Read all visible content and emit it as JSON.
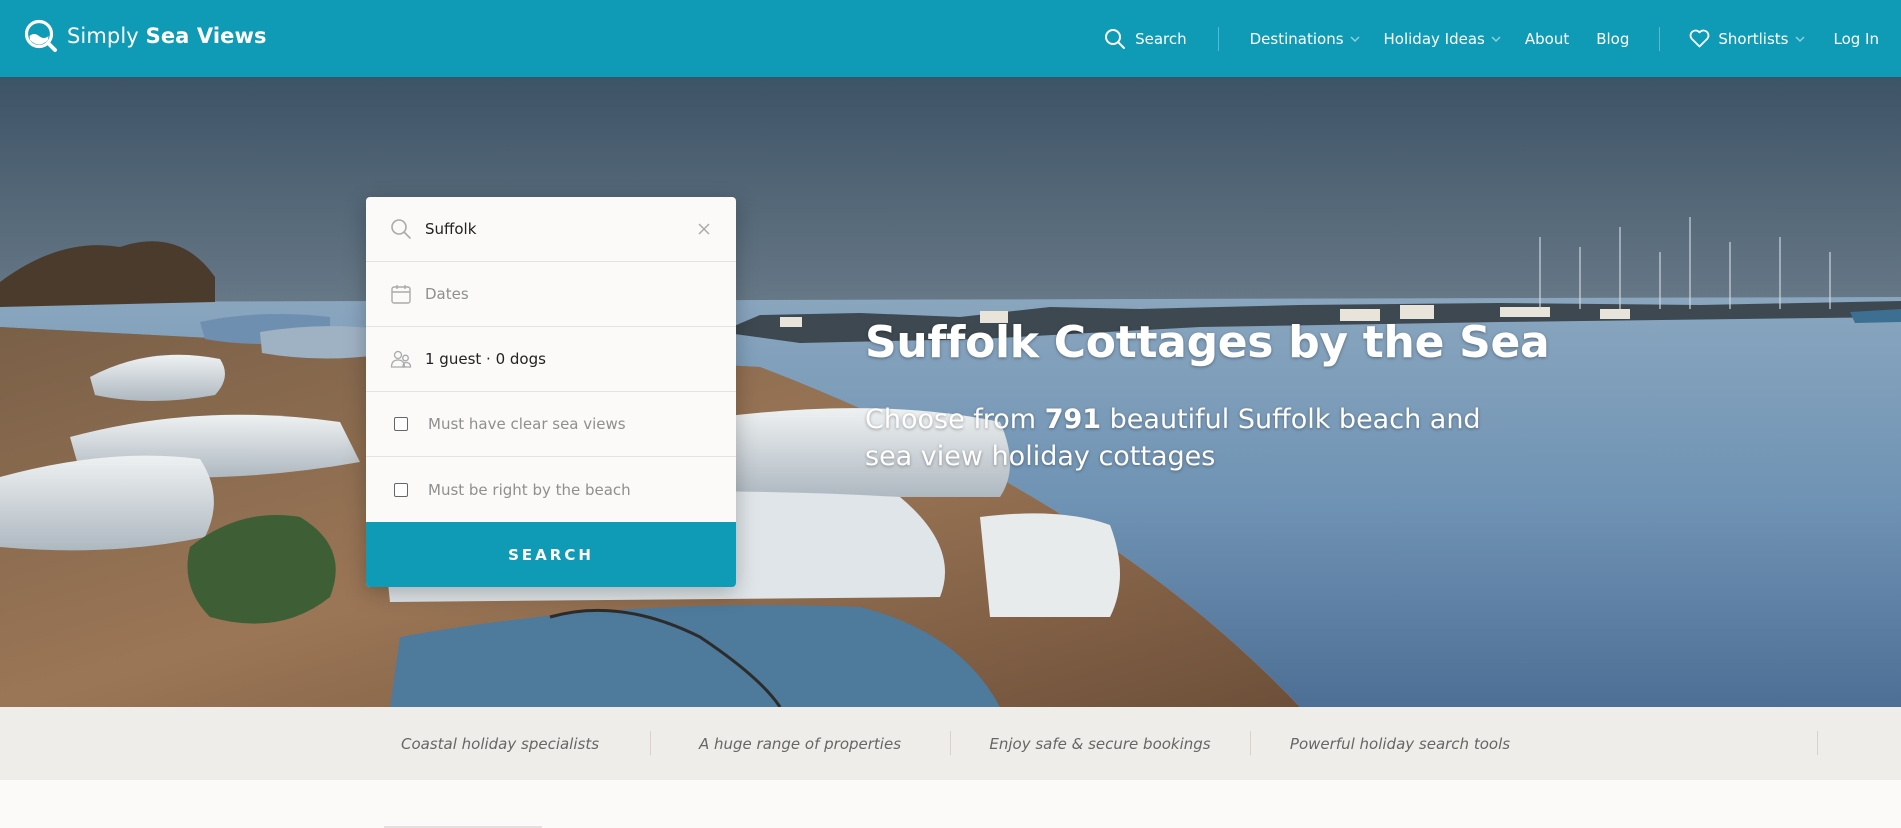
{
  "brand": {
    "name_light": "Simply",
    "name_bold": "Sea Views",
    "logo_icon": "magnifier-wave-icon"
  },
  "nav": {
    "search": "Search",
    "destinations": "Destinations",
    "holiday_ideas": "Holiday Ideas",
    "about": "About",
    "blog": "Blog",
    "shortlists": "Shortlists",
    "login": "Log In"
  },
  "search_panel": {
    "location_value": "Suffolk",
    "dates_placeholder": "Dates",
    "guests_value": "1 guest · 0 dogs",
    "sea_views_label": "Must have clear sea views",
    "sea_views_checked": false,
    "beach_label": "Must be right by the beach",
    "beach_checked": false,
    "button": "SEARCH"
  },
  "hero": {
    "title": "Suffolk Cottages by the Sea",
    "subtitle_pre": "Choose from ",
    "count": "791",
    "subtitle_post": " beautiful Suffolk beach and sea view holiday cottages"
  },
  "features": [
    "Coastal holiday specialists",
    "A huge range of properties",
    "Enjoy safe & secure bookings",
    "Powerful holiday search tools"
  ],
  "colors": {
    "brand": "#0f9bb5",
    "background": "#fbfaf8",
    "strip": "#efedea"
  }
}
